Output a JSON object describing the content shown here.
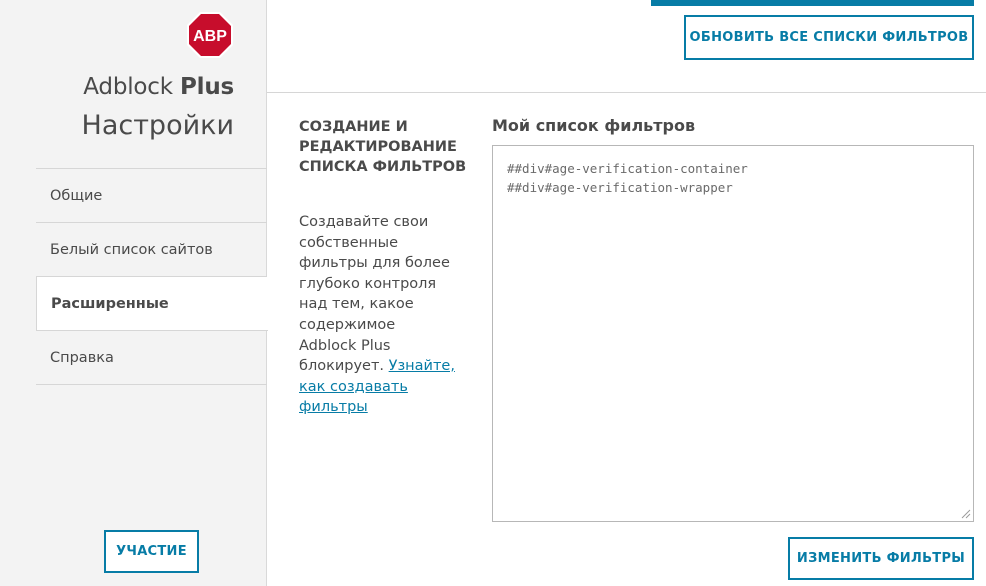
{
  "sidebar": {
    "logo_text": "ABP",
    "brand_regular": "Adblock",
    "brand_bold": "Plus",
    "title": "Настройки",
    "items": [
      {
        "label": "Общие",
        "active": false
      },
      {
        "label": "Белый список сайтов",
        "active": false
      },
      {
        "label": "Расширенные",
        "active": true
      },
      {
        "label": "Справка",
        "active": false
      }
    ],
    "participate_label": "УЧАСТИЕ"
  },
  "header": {
    "update_all_label": "ОБНОВИТЬ ВСЕ СПИСКИ ФИЛЬТРОВ"
  },
  "section": {
    "title": "СОЗДАНИЕ И РЕДАКТИРОВАНИЕ СПИСКА ФИЛЬТРОВ",
    "description": "Создавайте свои собственные фильтры для более глубоко контроля над тем, какое содержимое Adblock Plus блокирует.",
    "link_text": "Узнайте, как создавать фильтры"
  },
  "filters": {
    "label": "Мой список фильтров",
    "lines": [
      "##div#age-verification-container",
      "##div#age-verification-wrapper"
    ],
    "edit_label": "ИЗМЕНИТЬ ФИЛЬТРЫ"
  },
  "colors": {
    "accent": "#077ca6",
    "logo_red": "#c70d2c",
    "sidebar_bg": "#f3f3f3",
    "text": "#4a4a4a"
  },
  "icons": {
    "logo": "abp-octagon-icon",
    "resize": "resize-grip-icon"
  }
}
